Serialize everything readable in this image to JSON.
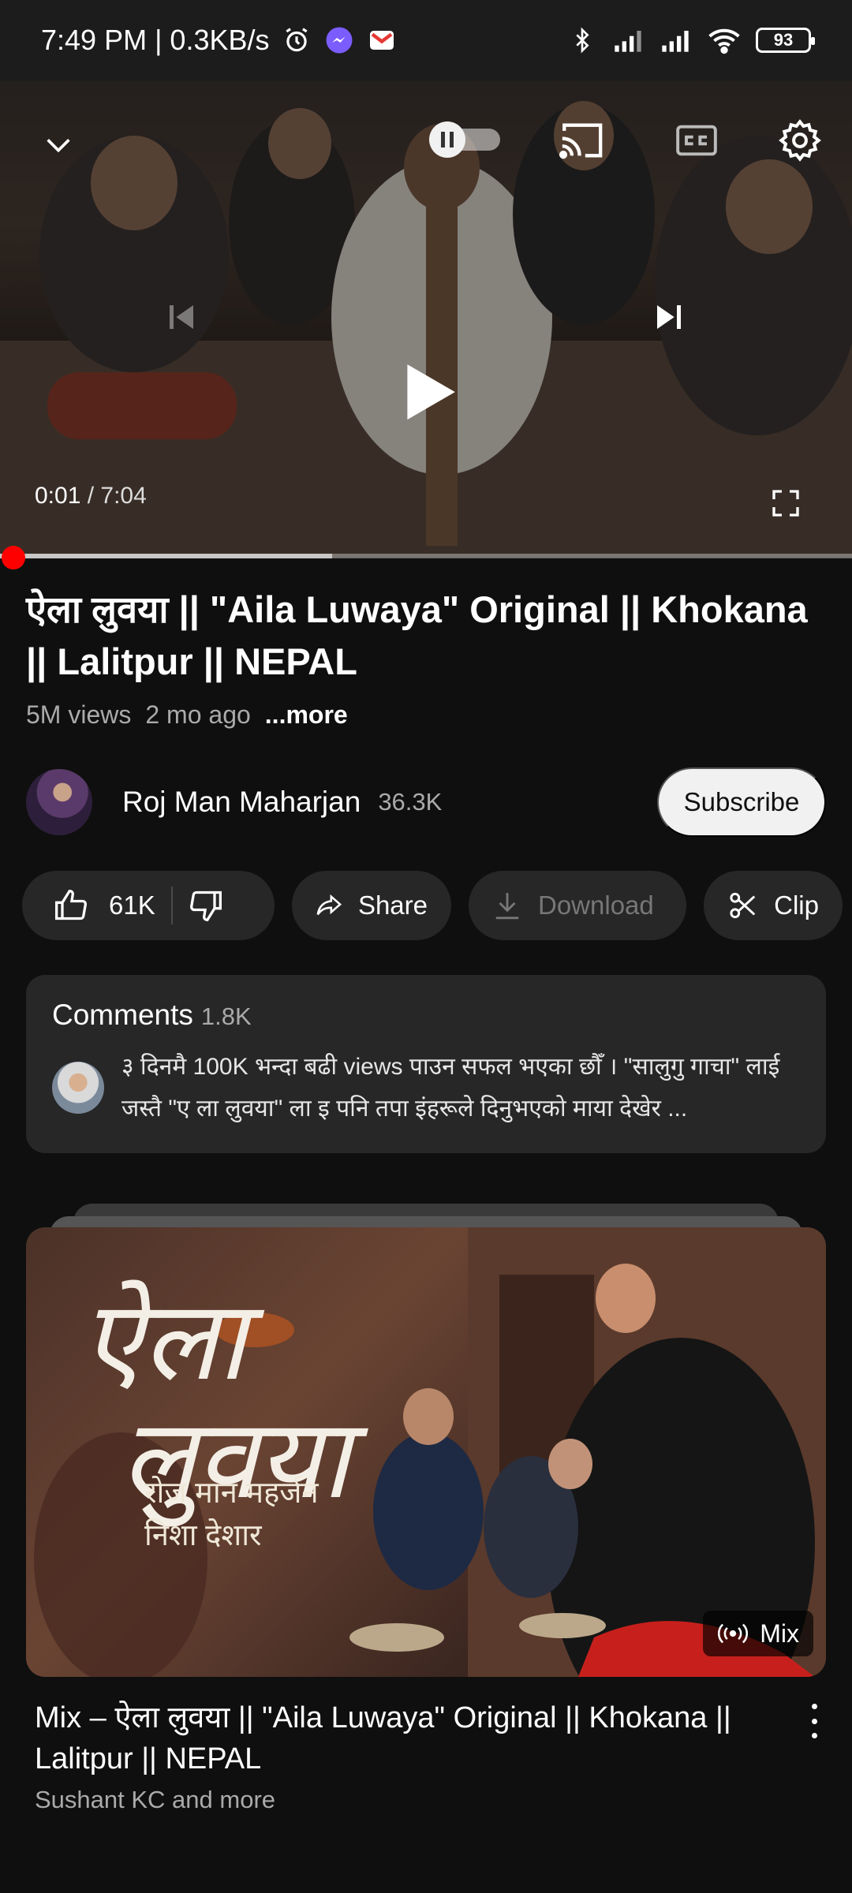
{
  "status_bar": {
    "time_speed": "7:49 PM | 0.3KB/s",
    "battery": "93",
    "icons": [
      "alarm-icon",
      "messenger-icon",
      "gmail-icon",
      "bluetooth-icon",
      "signal-icon",
      "signal-icon",
      "wifi-icon",
      "battery-icon"
    ]
  },
  "player": {
    "current_time": "0:01",
    "duration": " / 7:04",
    "progress_fraction": 0.0024,
    "buffer_fraction": 0.39,
    "autoplay_state": "paused",
    "icons": [
      "chevron-down-icon",
      "autoplay-toggle-icon",
      "cast-icon",
      "captions-icon",
      "settings-icon",
      "previous-icon",
      "play-icon",
      "next-icon",
      "fullscreen-icon"
    ]
  },
  "video": {
    "title": "ऐला लुवया || \"Aila Luwaya\" Original || Khokana || Lalitpur || NEPAL",
    "views": "5M views",
    "age": "2 mo ago",
    "more": "...more"
  },
  "channel": {
    "name": "Roj Man Maharjan",
    "subscribers": "36.3K",
    "subscribe_label": "Subscribe"
  },
  "actions": {
    "like_count": "61K",
    "share_label": "Share",
    "download_label": "Download",
    "clip_label": "Clip"
  },
  "comments": {
    "heading": "Comments",
    "count": "1.8K",
    "top_comment": "३ दिनमै 100K भन्दा बढी views पाउन सफल भएका छौँ । \"सालुगु गाचा\" लाई जस्तै \"ए ला लुवया\" ला इ पनि तपा इंहरूले दिनुभएको  माया देखेर ..."
  },
  "mix": {
    "thumb_title_line1": "ऐला",
    "thumb_title_line2": "लुवया",
    "thumb_artists_line1": "रोज मान महर्जन",
    "thumb_artists_line2": "निशा देशार",
    "badge": "Mix",
    "title": "Mix – ऐला लुवया || \"Aila Luwaya\" Original || Khokana || Lalitpur || NEPAL",
    "channel": "Sushant KC and more"
  },
  "colors": {
    "background": "#0f0f0f",
    "chip": "#272727",
    "progress": "#ff0000",
    "secondary_text": "#aaaaaa"
  }
}
